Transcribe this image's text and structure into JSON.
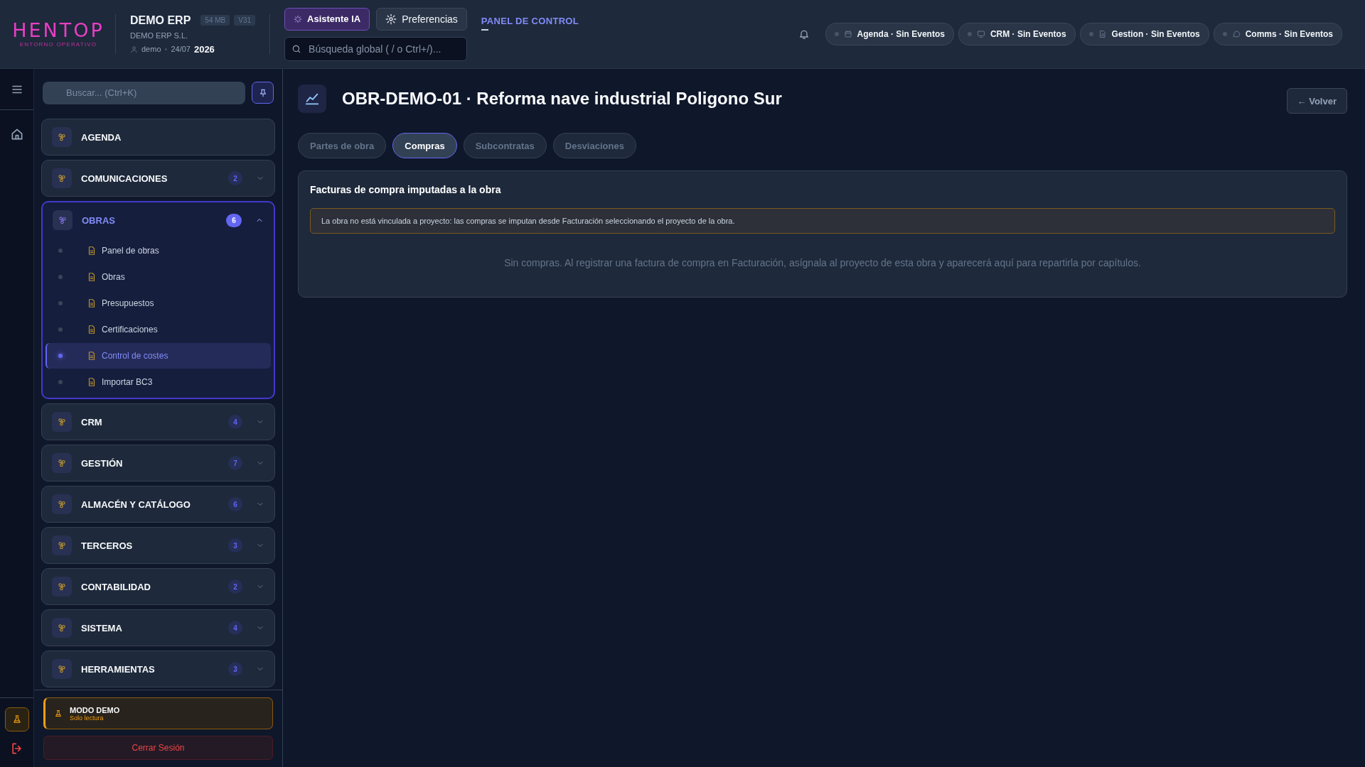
{
  "header": {
    "logo": {
      "wordmark": "HENTOP",
      "tagline": "ENTORNO OPERATIVO"
    },
    "company": {
      "name": "DEMO ERP",
      "badges": [
        "54 MB",
        "V31"
      ],
      "legal_name": "DEMO ERP S.L.",
      "user": "demo",
      "separator": "•",
      "date": "24/07",
      "year": "2026"
    },
    "buttons": [
      {
        "kind": "ai",
        "label": "Asistente IA"
      },
      {
        "kind": "settings",
        "label": "Preferencias"
      }
    ],
    "search": {
      "placeholder": "Búsqueda global ( / o Ctrl+/)..."
    },
    "section_title": "PANEL DE CONTROL",
    "status_pills": [
      {
        "kind": "calendar",
        "label": "Agenda · Sin Eventos"
      },
      {
        "kind": "monitor",
        "label": "CRM · Sin Eventos"
      },
      {
        "kind": "document",
        "label": "Gestion · Sin Eventos"
      },
      {
        "kind": "chat",
        "label": "Comms · Sin Eventos"
      }
    ]
  },
  "sidebar": {
    "search": {
      "placeholder": "Buscar... (Ctrl+K)"
    },
    "groups": [
      {
        "label": "AGENDA",
        "expanded": false
      },
      {
        "label": "COMUNICACIONES",
        "count": "2",
        "expanded": false
      },
      {
        "label": "OBRAS",
        "count": "6",
        "expanded": true,
        "children": [
          {
            "label": "Panel de obras",
            "selected": false
          },
          {
            "label": "Obras",
            "selected": false
          },
          {
            "label": "Presupuestos",
            "selected": false
          },
          {
            "label": "Certificaciones",
            "selected": false
          },
          {
            "label": "Control de costes",
            "selected": true
          },
          {
            "label": "Importar BC3",
            "selected": false
          }
        ]
      },
      {
        "label": "CRM",
        "count": "4",
        "expanded": false
      },
      {
        "label": "GESTIÓN",
        "count": "7",
        "expanded": false
      },
      {
        "label": "ALMACÉN Y CATÁLOGO",
        "count": "6",
        "expanded": false
      },
      {
        "label": "TERCEROS",
        "count": "3",
        "expanded": false
      },
      {
        "label": "CONTABILIDAD",
        "count": "2",
        "expanded": false
      },
      {
        "label": "SISTEMA",
        "count": "4",
        "expanded": false
      },
      {
        "label": "HERRAMIENTAS",
        "count": "3",
        "expanded": false
      }
    ],
    "demo_notice": {
      "title": "MODO DEMO",
      "subtitle": "Solo lectura"
    },
    "logout": "Cerrar Sesión"
  },
  "page": {
    "title": "OBR-DEMO-01 · Reforma nave industrial Poligono Sur",
    "back": "← Volver",
    "tabs": [
      {
        "label": "Partes de obra",
        "selected": false
      },
      {
        "label": "Compras",
        "selected": true
      },
      {
        "label": "Subcontratas",
        "selected": false
      },
      {
        "label": "Desviaciones",
        "selected": false
      }
    ],
    "panel": {
      "title": "Facturas de compra imputadas a la obra",
      "notice": "La obra no está vinculada a proyecto: las compras se imputan desde Facturación seleccionando el proyecto de la obra.",
      "empty_text": "Sin compras. Al registrar una factura de compra en Facturación, asígnala al proyecto de esta obra y aparecerá aquí para repartirla por capítulos."
    }
  }
}
